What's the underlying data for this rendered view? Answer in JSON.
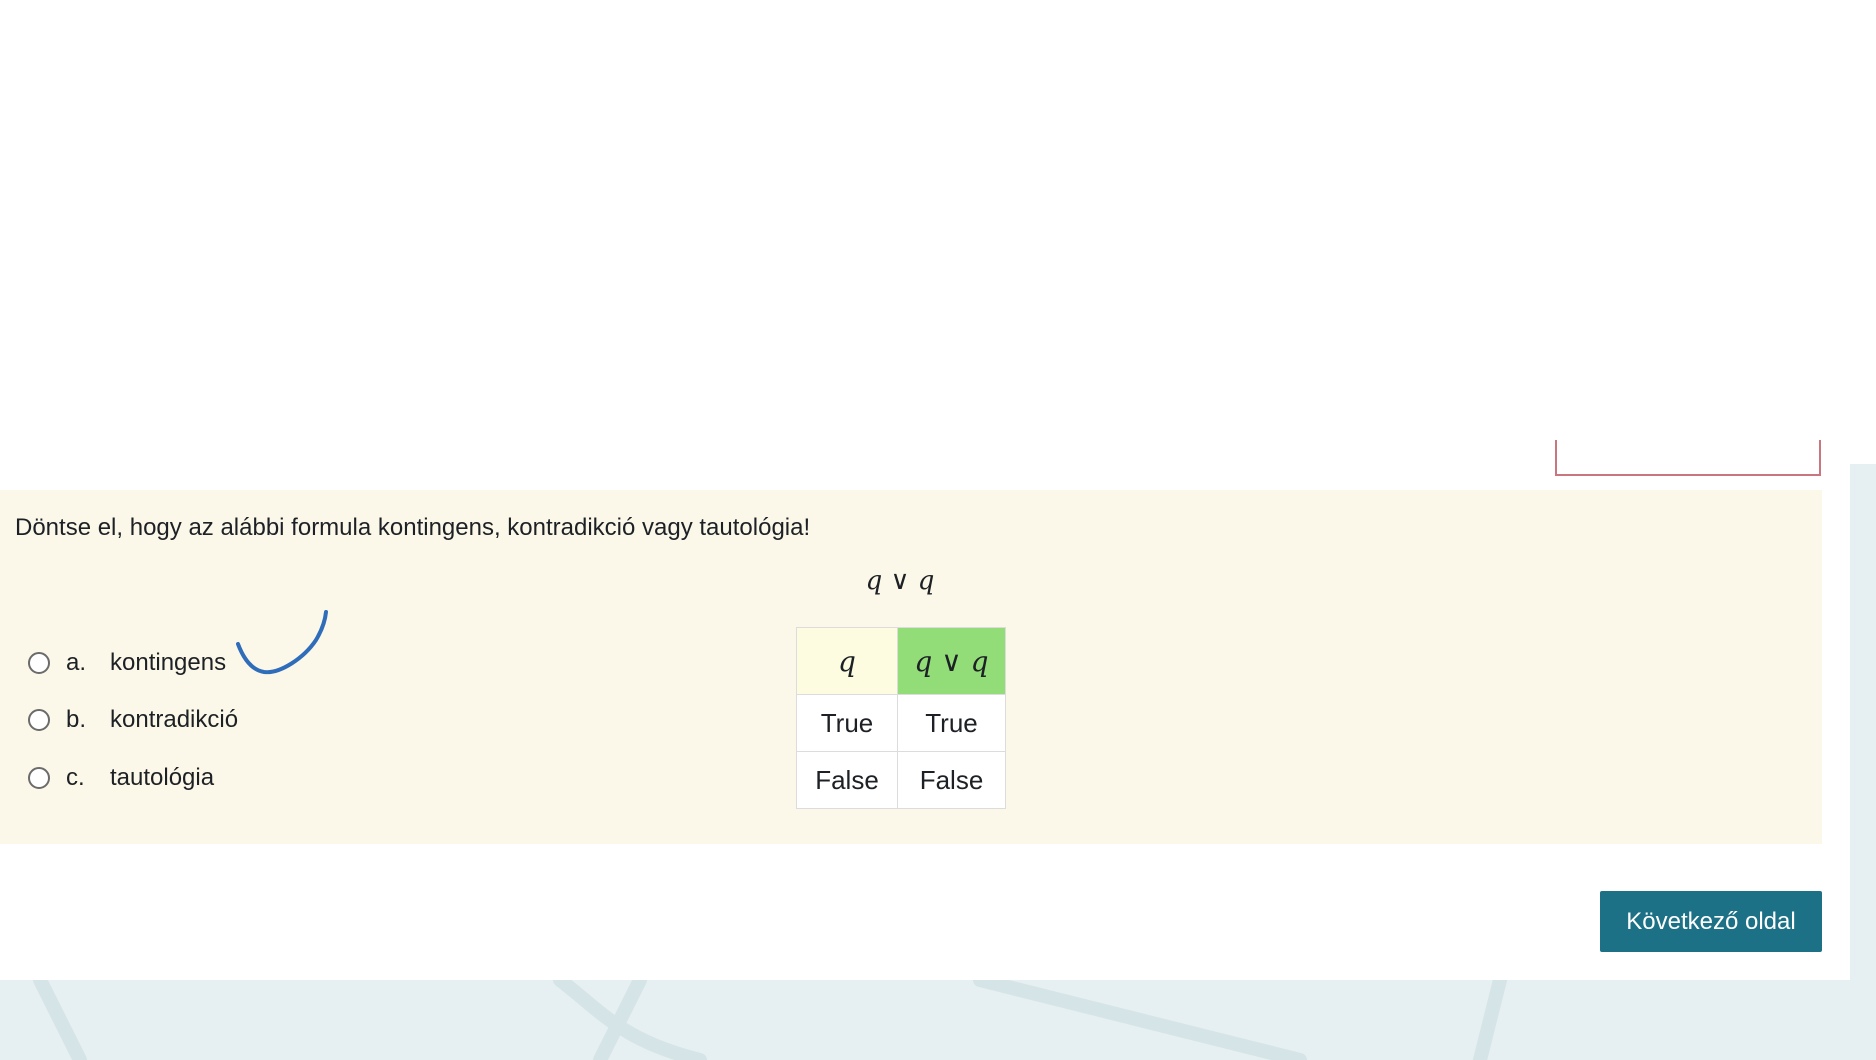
{
  "question": {
    "text": "Döntse el, hogy az alábbi formula kontingens, kontradikció vagy tautológia!",
    "formula": "q ∨ q"
  },
  "truth_table": {
    "headers": [
      "q",
      "q ∨ q"
    ],
    "rows": [
      [
        "True",
        "True"
      ],
      [
        "False",
        "False"
      ]
    ]
  },
  "options": [
    {
      "letter": "a.",
      "label": "kontingens",
      "selected": false
    },
    {
      "letter": "b.",
      "label": "kontradikció",
      "selected": false
    },
    {
      "letter": "c.",
      "label": "tautológia",
      "selected": false
    }
  ],
  "navigation": {
    "next_label": "Következő oldal"
  },
  "colors": {
    "question_background": "#fcf8e9",
    "result_header": "#92dd78",
    "variable_header": "#fdfce0",
    "button": "#1d7186",
    "annotation": "#2f6dbb"
  }
}
